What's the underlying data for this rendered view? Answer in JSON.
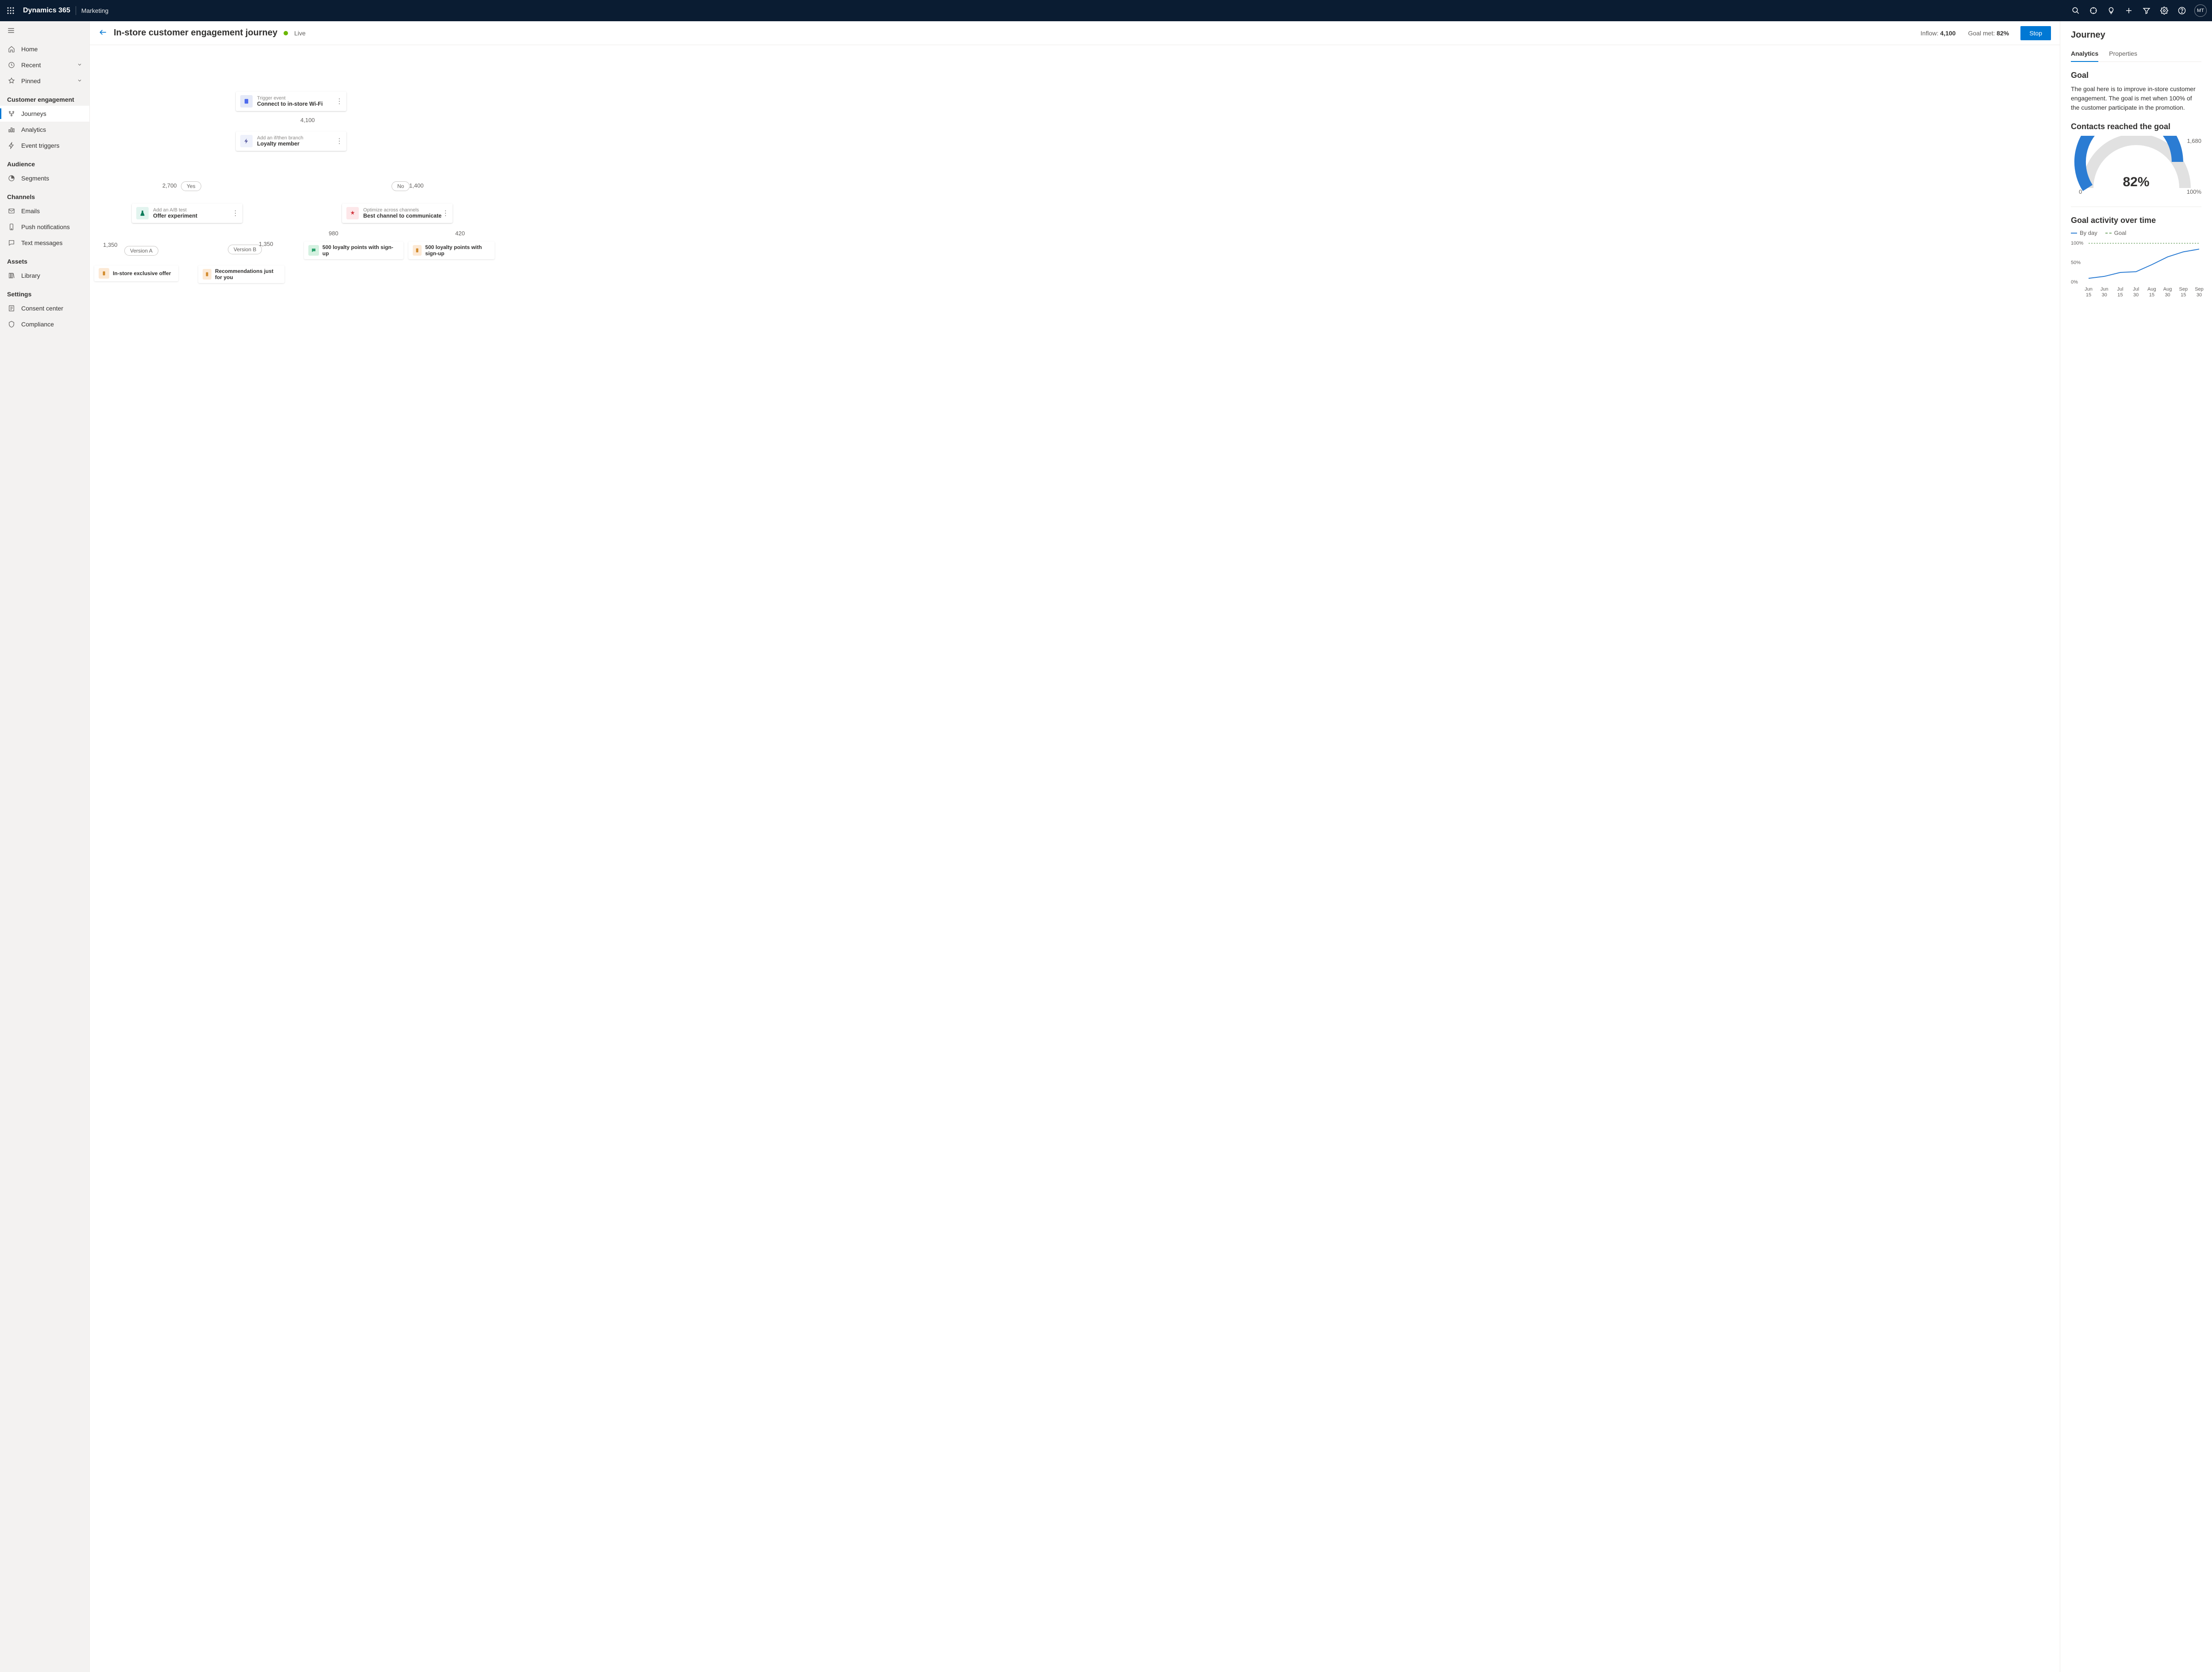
{
  "topbar": {
    "brand": "Dynamics 365",
    "module": "Marketing",
    "avatar_initials": "MT"
  },
  "sidebar": {
    "nav": [
      {
        "icon": "home",
        "label": "Home"
      },
      {
        "icon": "recent",
        "label": "Recent",
        "chevron": true
      },
      {
        "icon": "pin",
        "label": "Pinned",
        "chevron": true
      }
    ],
    "sections": [
      {
        "title": "Customer engagement",
        "items": [
          {
            "icon": "journey",
            "label": "Journeys",
            "selected": true
          },
          {
            "icon": "analytics",
            "label": "Analytics"
          },
          {
            "icon": "trigger",
            "label": "Event triggers"
          }
        ]
      },
      {
        "title": "Audience",
        "items": [
          {
            "icon": "segment",
            "label": "Segments"
          }
        ]
      },
      {
        "title": "Channels",
        "items": [
          {
            "icon": "mail",
            "label": "Emails"
          },
          {
            "icon": "push",
            "label": "Push notifications"
          },
          {
            "icon": "sms",
            "label": "Text messages"
          }
        ]
      },
      {
        "title": "Assets",
        "items": [
          {
            "icon": "library",
            "label": "Library"
          }
        ]
      },
      {
        "title": "Settings",
        "items": [
          {
            "icon": "consent",
            "label": "Consent center"
          },
          {
            "icon": "compliance",
            "label": "Compliance"
          }
        ]
      }
    ]
  },
  "header": {
    "title": "In-store customer engagement journey",
    "status": "Live",
    "inflow_label": "Inflow:",
    "inflow_value": "4,100",
    "goal_met_label": "Goal met:",
    "goal_met_value": "82%",
    "stop_button": "Stop"
  },
  "canvas": {
    "trigger": {
      "subtitle": "Trigger event",
      "title": "Connect to in-store Wi-Fi"
    },
    "trigger_count": "4,100",
    "branch": {
      "subtitle": "Add an if/then branch",
      "title": "Loyalty member"
    },
    "yes_label": "Yes",
    "yes_count": "2,700",
    "no_label": "No",
    "no_count": "1,400",
    "abtest": {
      "subtitle": "Add an A/B test",
      "title": "Offer experiment"
    },
    "version_a": "Version A",
    "version_a_count": "1,350",
    "version_b": "Version B",
    "version_b_count": "1,350",
    "offer_a": "In-store exclusive offer",
    "offer_b": "Recommendations just for you",
    "optimize": {
      "subtitle": "Optimize across channels",
      "title": "Best channel to communicate"
    },
    "opt_left_count": "980",
    "opt_right_count": "420",
    "loyalty_points": "500 loyalty points with sign-up"
  },
  "panel": {
    "title": "Journey",
    "tabs": {
      "analytics": "Analytics",
      "properties": "Properties"
    },
    "goal_heading": "Goal",
    "goal_text": "The goal here is to improve in-store customer engagement. The goal is met when 100% of the customer participate in the promotion.",
    "contacts_heading": "Contacts reached the goal",
    "gauge": {
      "value": "82%",
      "min": "0",
      "max": "100%",
      "count": "1,680"
    },
    "activity_heading": "Goal activity over time",
    "legend": {
      "by_day": "By day",
      "goal": "Goal"
    }
  },
  "chart_data": {
    "gauge": {
      "type": "gauge",
      "value_percent": 82,
      "count": 1680,
      "min": 0,
      "max": 100
    },
    "activity": {
      "type": "line",
      "title": "Goal activity over time",
      "ylabel": "",
      "ylim": [
        0,
        100
      ],
      "y_ticks": [
        "0%",
        "50%",
        "100%"
      ],
      "categories": [
        "Jun 15",
        "Jun 30",
        "Jul 15",
        "Jul 30",
        "Aug 15",
        "Aug 30",
        "Sep 15",
        "Sep 30"
      ],
      "series": [
        {
          "name": "By day",
          "values": [
            10,
            15,
            25,
            27,
            45,
            65,
            78,
            85
          ]
        },
        {
          "name": "Goal",
          "values": [
            100,
            100,
            100,
            100,
            100,
            100,
            100,
            100
          ],
          "style": "dashed"
        }
      ]
    }
  }
}
